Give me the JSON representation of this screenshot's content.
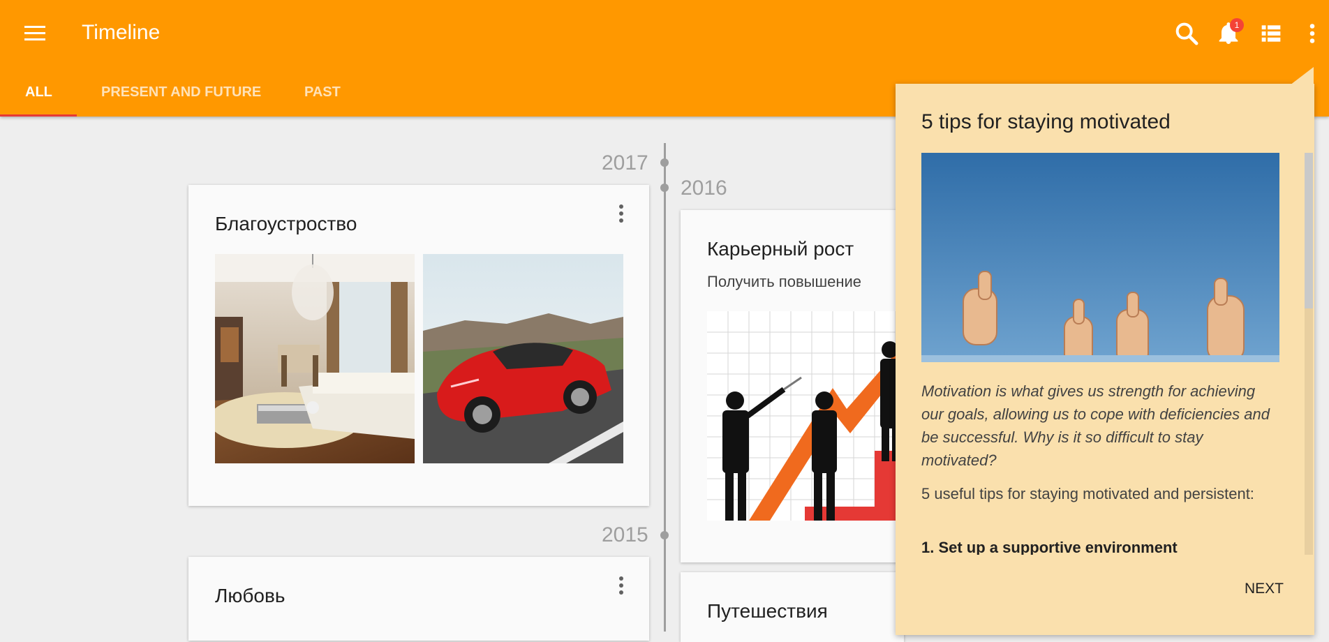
{
  "app": {
    "title": "Timeline",
    "notification_count": "1"
  },
  "tabs": [
    {
      "label": "ALL"
    },
    {
      "label": "PRESENT AND FUTURE"
    },
    {
      "label": "PAST"
    }
  ],
  "years": [
    "2017",
    "2016",
    "2015"
  ],
  "cards": [
    {
      "title": "Благоустроство"
    },
    {
      "title": "Карьерный рост",
      "subtitle": "Получить повышение"
    },
    {
      "title": "Любовь"
    },
    {
      "title": "Путешествия"
    }
  ],
  "tips": {
    "title": "5 tips for staying motivated",
    "intro": "Motivation is what gives us strength for achieving our goals, allowing us to cope with deficiencies and be successful. Why is it so difficult to stay motivated?",
    "body": "5 useful tips for staying motivated and persistent:",
    "first_tip": "1. Set up a supportive environment",
    "next_label": "NEXT"
  },
  "colors": {
    "app_bar": "#ff9800",
    "tab_indicator": "#e53935",
    "tips_panel": "#fae0ad",
    "badge": "#f44336"
  },
  "icons": [
    "menu-icon",
    "search-icon",
    "bell-icon",
    "view-list-icon",
    "more-vert-icon"
  ]
}
